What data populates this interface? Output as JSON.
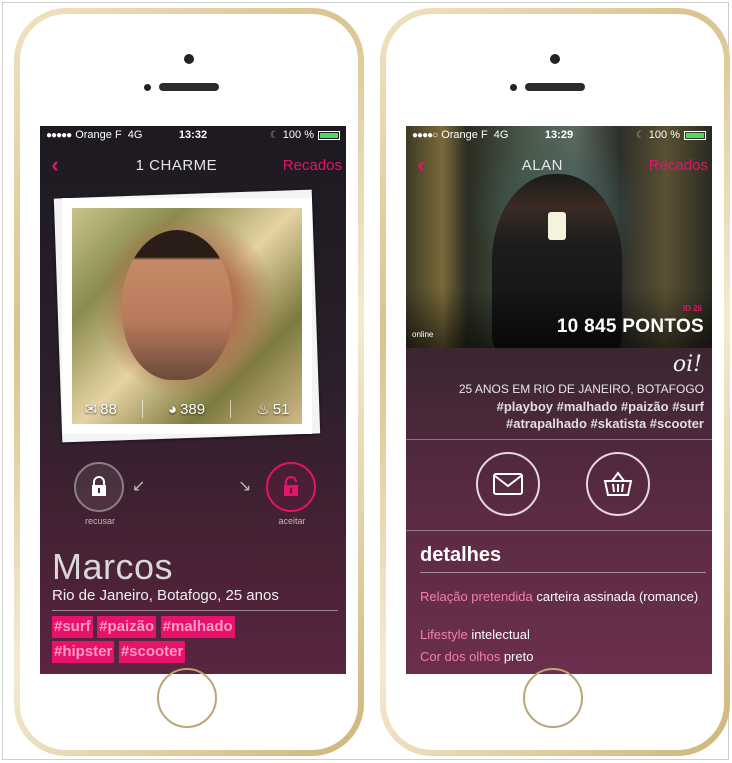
{
  "screen1": {
    "status": {
      "dots": "●●●●●",
      "carrier": "Orange F",
      "network": "4G",
      "time": "13:32",
      "battery": "100 %"
    },
    "nav": {
      "back": "‹",
      "title": "1 CHARME",
      "right": "Recados"
    },
    "stats": {
      "messages": "88",
      "views": "389",
      "gifts": "51"
    },
    "refuse_label": "recusar",
    "accept_label": "aceitar",
    "name": "Marcos",
    "city": "Rio de Janeiro, Botafogo, 25 anos",
    "tags": [
      "#surf",
      "#paizão",
      "#malhado",
      "#hipster",
      "#scooter"
    ]
  },
  "screen2": {
    "status": {
      "dots": "●●●●○",
      "carrier": "Orange F",
      "network": "4G",
      "time": "13:29",
      "battery": "100 %"
    },
    "nav": {
      "back": "‹",
      "title": "ALAN",
      "right": "Recados"
    },
    "online": "online",
    "rank": "ID 26",
    "points": "10 845 PONTOS",
    "greeting": "oi!",
    "info": "25 ANOS EM RIO DE JANEIRO, BOTAFOGO",
    "tags_line1": "#playboy #malhado #paizão #surf",
    "tags_line2": "#atrapalhado #skatista #scooter",
    "details_title": "detalhes",
    "details": [
      {
        "key": "Relação pretendida",
        "value": " carteira assinada (romance)"
      },
      {
        "key": "Lifestyle",
        "value": " intelectual"
      },
      {
        "key": "Cor dos olhos",
        "value": " preto"
      }
    ]
  },
  "colors": {
    "accent": "#e6126b",
    "battery": "#4cd964"
  }
}
